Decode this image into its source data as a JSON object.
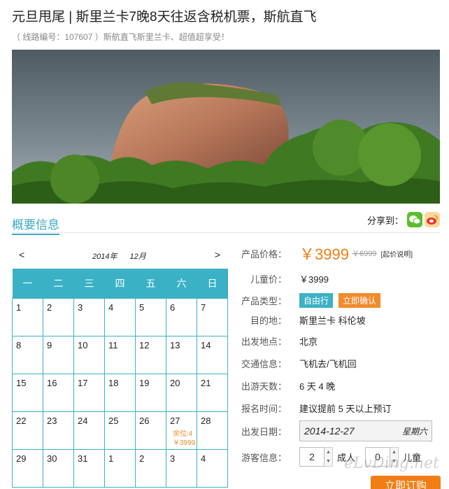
{
  "header": {
    "title": "元旦甩尾 | 斯里兰卡7晚8天往返含税机票，斯航直飞",
    "subtitle": "（ 线路编号：107607 ）斯航直飞斯里兰卡、超值超享受！"
  },
  "tabs": {
    "active": "概要信息"
  },
  "share": {
    "label": "分享到：",
    "icons": [
      "wechat-icon",
      "weibo-icon"
    ]
  },
  "calendar": {
    "prev": "<",
    "next": ">",
    "year": "2014年",
    "month": "12月",
    "weekdays": [
      "一",
      "二",
      "三",
      "四",
      "五",
      "六",
      "日"
    ],
    "weeks": [
      [
        "1",
        "2",
        "3",
        "4",
        "5",
        "6",
        "7"
      ],
      [
        "8",
        "9",
        "10",
        "11",
        "12",
        "13",
        "14"
      ],
      [
        "15",
        "16",
        "17",
        "18",
        "19",
        "20",
        "21"
      ],
      [
        "22",
        "23",
        "24",
        "25",
        "26",
        "27",
        "28"
      ],
      [
        "29",
        "30",
        "31",
        "1",
        "2",
        "3",
        "4"
      ]
    ],
    "special": {
      "remain": "余位:4",
      "price": "￥3999"
    }
  },
  "info": {
    "price_label": "产品价格：",
    "price": "￥3999",
    "price_old": "￥6999",
    "price_note": "[起价说明]",
    "child_label": "儿童价：",
    "child_price": "￥3999",
    "type_label": "产品类型：",
    "type_badges": [
      "自由行",
      "立即确认"
    ],
    "dest_label": "目的地：",
    "dest": "斯里兰卡 科伦坡",
    "depart_label": "出发地点：",
    "depart": "北京",
    "traffic_label": "交通信息：",
    "traffic": "飞机去/飞机回",
    "days_label": "出游天数：",
    "days": "6 天 4 晚",
    "signup_label": "报名时间：",
    "signup": "建议提前 5 天以上预订",
    "date_label": "出发日期：",
    "date": "2014-12-27",
    "weekday": "星期六",
    "guest_label": "游客信息：",
    "adults": "2",
    "adult_unit": "成人",
    "children": "0",
    "child_unit": "儿童",
    "book": "立即订购"
  },
  "watermark": "eLvDing.net",
  "colors": {
    "accent": "#3bb1c6",
    "price": "#f07e14"
  }
}
